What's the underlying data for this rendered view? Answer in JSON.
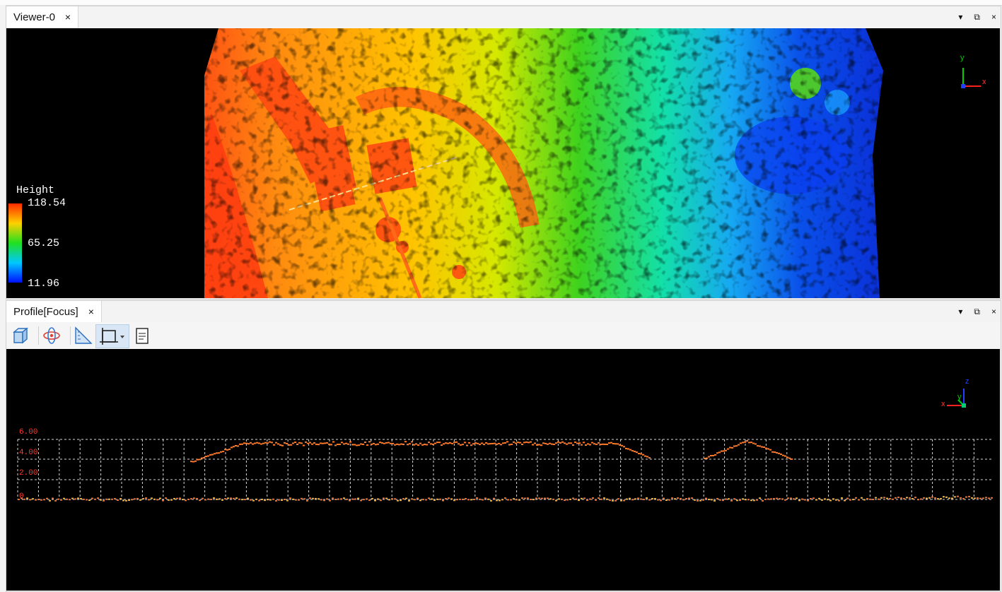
{
  "viewer": {
    "tab_title": "Viewer-0",
    "tab_close": "×",
    "legend": {
      "title": "Height",
      "max": "118.54",
      "mid": "65.25",
      "min": "11.96"
    },
    "axis": {
      "y": "y",
      "x": "x"
    }
  },
  "profile": {
    "tab_title": "Profile[Focus]",
    "tab_close": "×",
    "toolbar": [
      {
        "icon": "cube-view-icon"
      },
      {
        "icon": "orbit-icon"
      },
      {
        "icon": "ruler-triangle-icon"
      },
      {
        "icon": "crop-frame-icon",
        "active": true
      },
      {
        "icon": "notes-document-icon"
      }
    ],
    "axis": {
      "z": "z",
      "x": "x",
      "y": "y"
    },
    "y_labels": [
      "6.00",
      "4.00",
      "2.00",
      "0"
    ]
  },
  "window_controls": {
    "menu": "▾",
    "restore": "⧉",
    "close": "×"
  },
  "colors": {
    "viewport_bg": "#000000",
    "grid": "#ffffff",
    "profile_label": "#ff3b2f",
    "points": "#ff7a2a"
  }
}
